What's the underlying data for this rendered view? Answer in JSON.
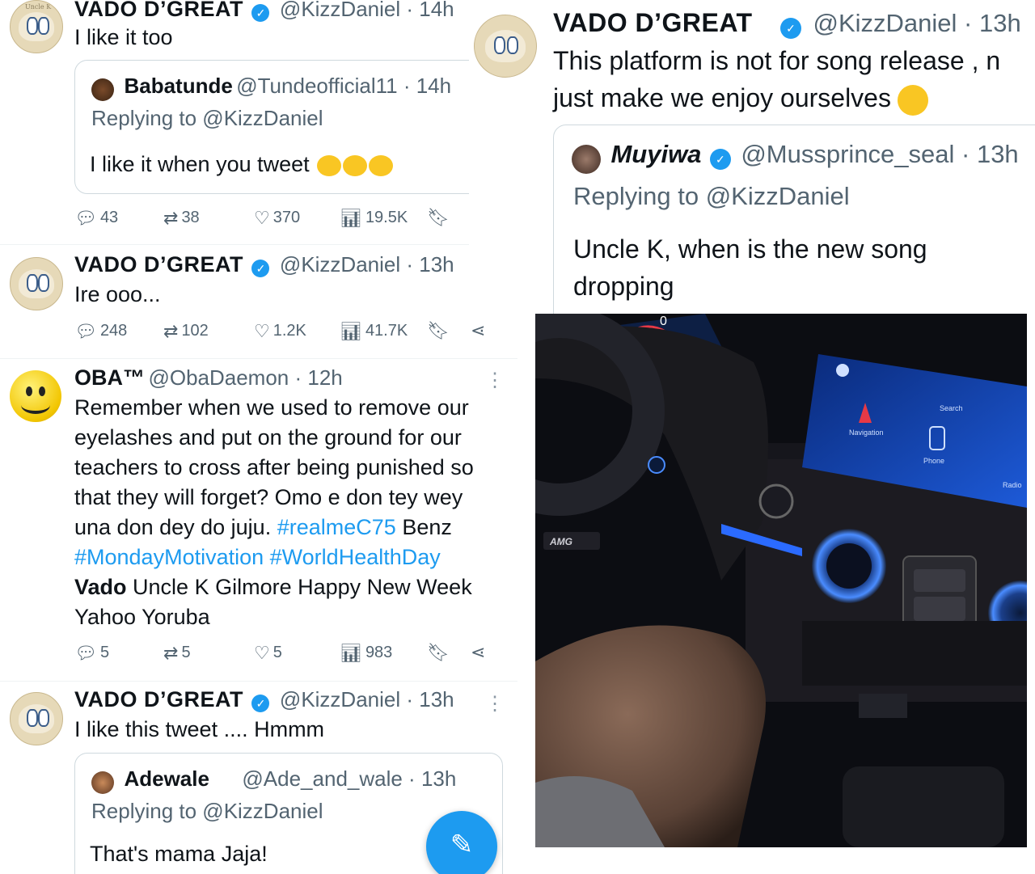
{
  "tweets": [
    {
      "name": "VADO D’GREAT",
      "handle": "@KizzDaniel · 14h",
      "text": "I like it too",
      "quote": {
        "name": "Babatunde",
        "handle": "@Tundeofficial11 · 14h",
        "replying": "Replying to @KizzDaniel",
        "text": "I like it when you tweet"
      },
      "stats": {
        "replies": "43",
        "reposts": "38",
        "likes": "370",
        "views": "19.5K"
      }
    },
    {
      "name": "VADO D’GREAT",
      "handle": "@KizzDaniel · 13h",
      "text": "Ire ooo...",
      "stats": {
        "replies": "248",
        "reposts": "102",
        "likes": "1.2K",
        "views": "41.7K"
      }
    },
    {
      "name": "OBA™",
      "handle": "@ObaDaemon · 12h",
      "text_lines": [
        "Remember when we used to remove our",
        "eyelashes and put on the ground for our",
        "teachers to cross after being punished so",
        "that they will forget? Omo e don tey wey"
      ],
      "line5_text": "una don dey do juju.",
      "line5_tag": "#realmeC75",
      "line5_after": "Benz",
      "line6_tag1": "#MondayMotivation",
      "line6_tag2": "#WorldHealthDay",
      "line7_bold": "Vado",
      "line7_text": "Uncle K Gilmore Happy New Week",
      "line8_text": "Yahoo Yoruba",
      "stats": {
        "replies": "5",
        "reposts": "5",
        "likes": "5",
        "views": "983"
      }
    },
    {
      "name": "VADO D’GREAT",
      "handle": "@KizzDaniel · 13h",
      "text": "I like this tweet .... Hmmm",
      "quote": {
        "name": "Adewale",
        "handle": "@Ade_and_wale · 13h",
        "replying": "Replying to @KizzDaniel",
        "text": "That's mama Jaja!"
      }
    }
  ],
  "right_tweet": {
    "name": "VADO D’GREAT",
    "handle": "@KizzDaniel · 13h",
    "text_line1": "This platform is not for song release , n",
    "text_line2": "just make we enjoy ourselves",
    "quote": {
      "name": "Muyiwa",
      "handle": "@Mussprince_seal · 13h",
      "replying": "Replying to @KizzDaniel",
      "text_line1": "Uncle K, when is the new song",
      "text_line2": "dropping"
    }
  },
  "avatar_label": "Uncle K",
  "photo": {
    "screen_nav_label": "Navigation",
    "screen_phone_label": "Phone",
    "screen_radio_label": "Radio",
    "screen_search_label": "Search",
    "dash_badge": "AMG",
    "dash_readout": "0"
  },
  "colors": {
    "accent": "#1d9bf0",
    "muted": "#536471",
    "border": "#cfd9de"
  }
}
